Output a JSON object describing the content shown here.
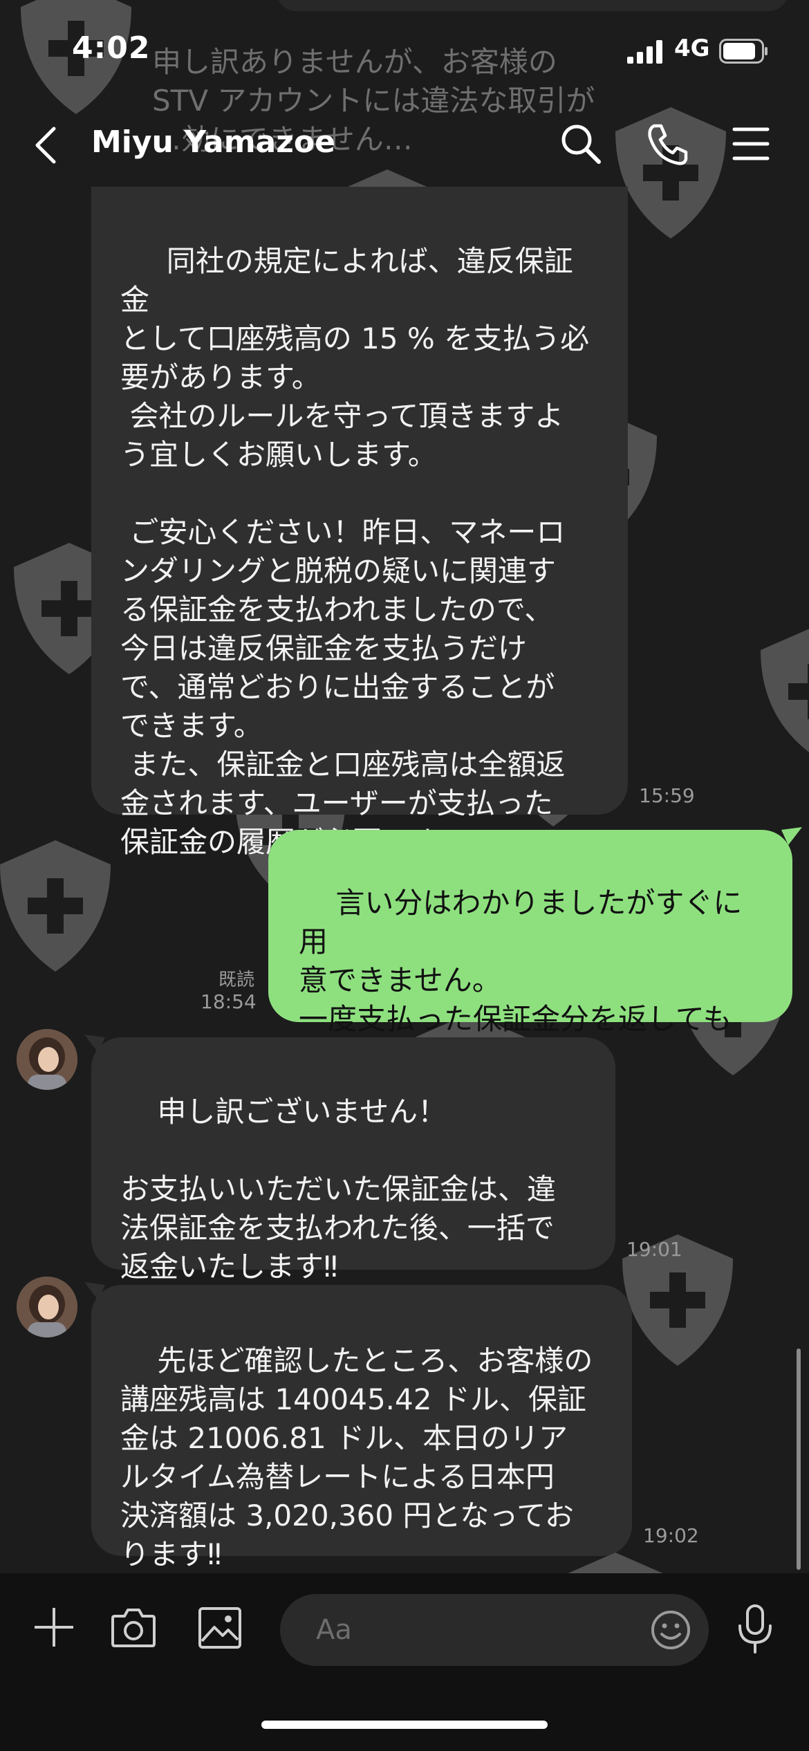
{
  "status_bar": {
    "time": "4:02",
    "network": "4G"
  },
  "background_text": "申し訳ありませんが、お客様の\nSTV アカウントには違法な取引が\n…効にできません…",
  "header": {
    "contact_name": "Miyu Yamazoe",
    "icons": [
      "back-icon",
      "search-icon",
      "phone-icon",
      "menu-icon"
    ]
  },
  "messages": [
    {
      "direction": "incoming",
      "text": " 同社の規定によれば、違反保証金\nとして口座残高の 15 % を支払う必\n要があります。\n 会社のルールを守って頂きますよ\nう宜しくお願いします。\n\n ご安心ください！昨日、マネーロ\nンダリングと脱税の疑いに関連す\nる保証金を支払われましたので、\n今日は違反保証金を支払うだけ\nで、通常どおりに出金することが\nできます。\n また、保証金と口座残高は全額返\n金されます、ユーザーが支払った\n保証金の履歴が必要です。",
      "time": "15:59"
    },
    {
      "direction": "outgoing",
      "text": "言い分はわかりましたがすぐに用\n意できません。\n一度支払った保証金分を返しても\nらえますか？",
      "read": "既読",
      "time": "18:54"
    },
    {
      "direction": "incoming",
      "text": "申し訳ございません！\n\nお支払いいただいた保証金は、違\n法保証金を支払われた後、一括で\n返金いたします‼",
      "time": "19:01"
    },
    {
      "direction": "incoming",
      "text": "先ほど確認したところ、お客様の\n講座残高は 140045.42 ドル、保証\n金は 21006.81 ドル、本日のリア\nルタイム為替レートによる日本円\n決済額は 3,020,360 円となってお\nります‼",
      "time": "19:02"
    }
  ],
  "input_bar": {
    "placeholder": "Aa",
    "icons": [
      "plus-icon",
      "camera-icon",
      "image-icon",
      "emoji-icon",
      "microphone-icon"
    ]
  },
  "colors": {
    "background": "#1c1c1c",
    "incoming_bubble": "#2f2f2f",
    "outgoing_bubble": "#8ee07f",
    "timestamp": "#9b9b9b"
  }
}
